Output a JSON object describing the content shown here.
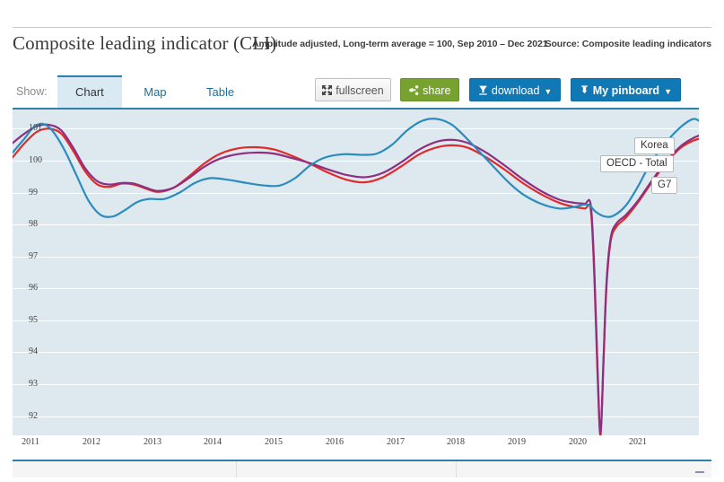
{
  "header": {
    "title": "Composite leading indicator (CLI)",
    "subtitle": "Amplitude adjusted, Long-term average = 100, Sep 2010 – Dec 2021",
    "source": "Source: Composite leading indicators"
  },
  "toolbar": {
    "show_label": "Show:",
    "tabs": [
      {
        "label": "Chart",
        "active": true
      },
      {
        "label": "Map",
        "active": false
      },
      {
        "label": "Table",
        "active": false
      }
    ],
    "buttons": {
      "fullscreen": "fullscreen",
      "share": "share",
      "download": "download",
      "pinboard": "My pinboard",
      "caret": "▼"
    }
  },
  "colors": {
    "korea": "#2b8cbe",
    "oecd_total": "#8e2f7f",
    "g7": "#e02b2b",
    "plot_background": "#dde8ef",
    "accent": "#2e7faa",
    "gridline": "#ffffff",
    "share_button": "#78a22f",
    "blue_button": "#1079b5"
  },
  "chart_data": {
    "type": "line",
    "title": "Composite leading indicator (CLI)",
    "subtitle": "Amplitude adjusted, Long-term average = 100, Sep 2010 – Dec 2021",
    "xlabel": "",
    "ylabel": "",
    "ylim": [
      91.4,
      101.6
    ],
    "xlim": [
      2010.7,
      2022.0
    ],
    "yticks": [
      92,
      93,
      94,
      95,
      96,
      97,
      98,
      99,
      100,
      101
    ],
    "xticks": [
      2011,
      2012,
      2013,
      2014,
      2015,
      2016,
      2017,
      2018,
      2019,
      2020,
      2021
    ],
    "grid": true,
    "legend_position": "inline-callout-right",
    "series": [
      {
        "name": "Korea",
        "color": "#2b8cbe",
        "points": [
          [
            2010.7,
            100.25
          ],
          [
            2010.9,
            100.7
          ],
          [
            2011.05,
            101.05
          ],
          [
            2011.2,
            101.15
          ],
          [
            2011.35,
            100.95
          ],
          [
            2011.55,
            100.35
          ],
          [
            2011.75,
            99.55
          ],
          [
            2011.95,
            98.75
          ],
          [
            2012.15,
            98.3
          ],
          [
            2012.35,
            98.25
          ],
          [
            2012.55,
            98.45
          ],
          [
            2012.75,
            98.7
          ],
          [
            2012.95,
            98.8
          ],
          [
            2013.2,
            98.8
          ],
          [
            2013.45,
            99.0
          ],
          [
            2013.7,
            99.3
          ],
          [
            2013.95,
            99.45
          ],
          [
            2014.25,
            99.4
          ],
          [
            2014.55,
            99.3
          ],
          [
            2014.85,
            99.22
          ],
          [
            2015.1,
            99.22
          ],
          [
            2015.35,
            99.45
          ],
          [
            2015.6,
            99.85
          ],
          [
            2015.85,
            100.1
          ],
          [
            2016.15,
            100.2
          ],
          [
            2016.45,
            100.18
          ],
          [
            2016.7,
            100.22
          ],
          [
            2016.95,
            100.5
          ],
          [
            2017.2,
            100.95
          ],
          [
            2017.45,
            101.25
          ],
          [
            2017.7,
            101.3
          ],
          [
            2017.95,
            101.1
          ],
          [
            2018.25,
            100.55
          ],
          [
            2018.55,
            99.95
          ],
          [
            2018.85,
            99.35
          ],
          [
            2019.1,
            98.95
          ],
          [
            2019.4,
            98.65
          ],
          [
            2019.7,
            98.5
          ],
          [
            2019.95,
            98.55
          ],
          [
            2020.1,
            98.62
          ],
          [
            2020.2,
            98.6
          ],
          [
            2020.3,
            98.4
          ],
          [
            2020.45,
            98.25
          ],
          [
            2020.6,
            98.28
          ],
          [
            2020.8,
            98.6
          ],
          [
            2021.0,
            99.2
          ],
          [
            2021.2,
            99.9
          ],
          [
            2021.45,
            100.55
          ],
          [
            2021.7,
            101.05
          ],
          [
            2021.9,
            101.3
          ],
          [
            2022.0,
            101.25
          ]
        ]
      },
      {
        "name": "OECD - Total",
        "color": "#8e2f7f",
        "points": [
          [
            2010.7,
            100.55
          ],
          [
            2010.9,
            100.85
          ],
          [
            2011.1,
            101.08
          ],
          [
            2011.3,
            101.12
          ],
          [
            2011.5,
            100.95
          ],
          [
            2011.7,
            100.4
          ],
          [
            2011.9,
            99.75
          ],
          [
            2012.1,
            99.35
          ],
          [
            2012.3,
            99.25
          ],
          [
            2012.5,
            99.3
          ],
          [
            2012.7,
            99.28
          ],
          [
            2012.9,
            99.15
          ],
          [
            2013.1,
            99.05
          ],
          [
            2013.35,
            99.15
          ],
          [
            2013.6,
            99.45
          ],
          [
            2013.85,
            99.8
          ],
          [
            2014.1,
            100.05
          ],
          [
            2014.4,
            100.2
          ],
          [
            2014.7,
            100.25
          ],
          [
            2015.0,
            100.22
          ],
          [
            2015.3,
            100.08
          ],
          [
            2015.6,
            99.92
          ],
          [
            2015.9,
            99.72
          ],
          [
            2016.2,
            99.55
          ],
          [
            2016.5,
            99.48
          ],
          [
            2016.8,
            99.62
          ],
          [
            2017.1,
            99.95
          ],
          [
            2017.4,
            100.35
          ],
          [
            2017.7,
            100.6
          ],
          [
            2017.95,
            100.65
          ],
          [
            2018.2,
            100.55
          ],
          [
            2018.5,
            100.25
          ],
          [
            2018.8,
            99.85
          ],
          [
            2019.1,
            99.42
          ],
          [
            2019.4,
            99.05
          ],
          [
            2019.7,
            98.78
          ],
          [
            2019.95,
            98.68
          ],
          [
            2020.12,
            98.65
          ],
          [
            2020.22,
            98.6
          ],
          [
            2020.28,
            96.5
          ],
          [
            2020.33,
            93.6
          ],
          [
            2020.38,
            91.45
          ],
          [
            2020.43,
            93.8
          ],
          [
            2020.48,
            96.2
          ],
          [
            2020.55,
            97.6
          ],
          [
            2020.65,
            98.05
          ],
          [
            2020.8,
            98.3
          ],
          [
            2021.0,
            98.75
          ],
          [
            2021.2,
            99.3
          ],
          [
            2021.45,
            99.95
          ],
          [
            2021.7,
            100.45
          ],
          [
            2021.9,
            100.7
          ],
          [
            2022.0,
            100.78
          ]
        ]
      },
      {
        "name": "G7",
        "color": "#e02b2b",
        "points": [
          [
            2010.7,
            100.1
          ],
          [
            2010.9,
            100.55
          ],
          [
            2011.1,
            100.9
          ],
          [
            2011.3,
            101.0
          ],
          [
            2011.5,
            100.85
          ],
          [
            2011.7,
            100.3
          ],
          [
            2011.9,
            99.65
          ],
          [
            2012.1,
            99.25
          ],
          [
            2012.3,
            99.18
          ],
          [
            2012.5,
            99.28
          ],
          [
            2012.7,
            99.25
          ],
          [
            2012.9,
            99.12
          ],
          [
            2013.1,
            99.02
          ],
          [
            2013.35,
            99.15
          ],
          [
            2013.6,
            99.5
          ],
          [
            2013.85,
            99.9
          ],
          [
            2014.1,
            100.2
          ],
          [
            2014.4,
            100.38
          ],
          [
            2014.7,
            100.42
          ],
          [
            2015.0,
            100.35
          ],
          [
            2015.3,
            100.15
          ],
          [
            2015.6,
            99.9
          ],
          [
            2015.9,
            99.62
          ],
          [
            2016.2,
            99.4
          ],
          [
            2016.5,
            99.32
          ],
          [
            2016.8,
            99.48
          ],
          [
            2017.1,
            99.82
          ],
          [
            2017.4,
            100.2
          ],
          [
            2017.7,
            100.42
          ],
          [
            2017.95,
            100.48
          ],
          [
            2018.2,
            100.4
          ],
          [
            2018.5,
            100.1
          ],
          [
            2018.8,
            99.72
          ],
          [
            2019.1,
            99.3
          ],
          [
            2019.4,
            98.95
          ],
          [
            2019.7,
            98.68
          ],
          [
            2019.95,
            98.55
          ],
          [
            2020.12,
            98.5
          ],
          [
            2020.22,
            98.45
          ],
          [
            2020.28,
            96.3
          ],
          [
            2020.33,
            93.4
          ],
          [
            2020.38,
            91.4
          ],
          [
            2020.43,
            93.7
          ],
          [
            2020.48,
            96.1
          ],
          [
            2020.55,
            97.5
          ],
          [
            2020.65,
            97.95
          ],
          [
            2020.8,
            98.22
          ],
          [
            2021.0,
            98.7
          ],
          [
            2021.2,
            99.25
          ],
          [
            2021.45,
            99.9
          ],
          [
            2021.7,
            100.4
          ],
          [
            2021.9,
            100.62
          ],
          [
            2022.0,
            100.68
          ]
        ]
      }
    ],
    "annotations": [
      {
        "label": "Korea",
        "series": "Korea"
      },
      {
        "label": "OECD - Total",
        "series": "OECD - Total"
      },
      {
        "label": "G7",
        "series": "G7"
      }
    ]
  }
}
